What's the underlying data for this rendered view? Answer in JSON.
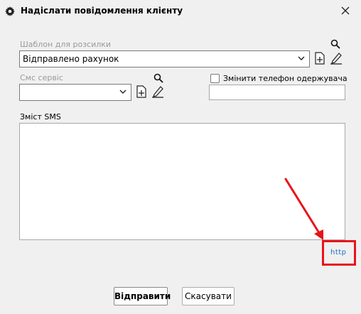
{
  "dialog": {
    "title": "Надіслати повідомлення клієнту",
    "close_icon": "close-icon",
    "title_icon": "gear-icon"
  },
  "template": {
    "label": "Шаблон для розсилки",
    "value": "Відправлено рахунок",
    "icons": [
      "search-icon",
      "add-icon",
      "edit-icon"
    ]
  },
  "sms_service": {
    "label": "Смс сервіс",
    "value": "",
    "icons": [
      "search-icon",
      "add-icon",
      "edit-icon"
    ]
  },
  "change_phone": {
    "label": "Змінити телефон одержувача",
    "checked": false,
    "value": ""
  },
  "sms_content": {
    "label": "Зміст SMS",
    "value": ""
  },
  "http_link": {
    "label": "http"
  },
  "annotation": {
    "color": "#e8141b"
  },
  "buttons": {
    "send": "Відправити",
    "cancel": "Скасувати"
  }
}
